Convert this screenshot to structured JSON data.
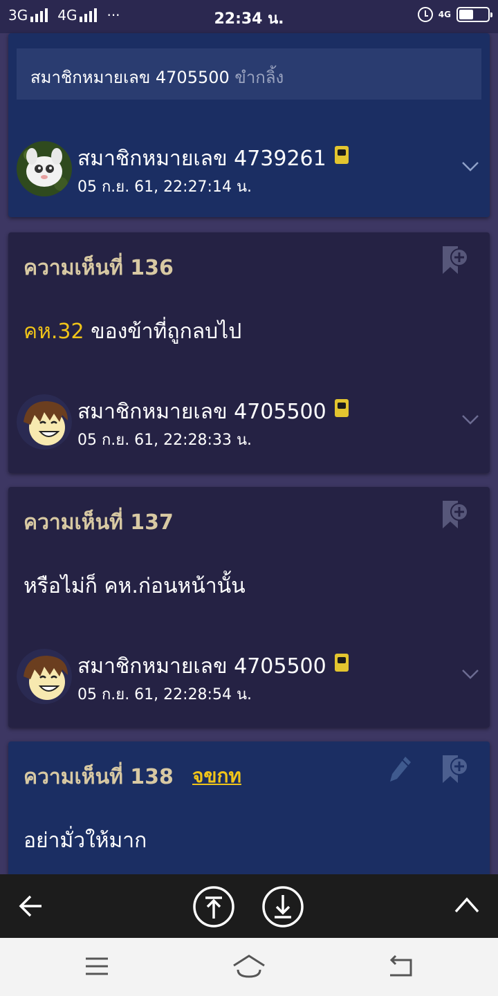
{
  "status_bar": {
    "left": [
      "3G",
      "4G",
      "···"
    ],
    "time": "22:34 น.",
    "network_right": "4G"
  },
  "top_card": {
    "quote": {
      "name": "สมาชิกหมายเลข 4705500",
      "note": "ขำกลิ้ง"
    },
    "user": {
      "name": "สมาชิกหมายเลข 4739261",
      "date": "05 ก.ย. 61, 22:27:14 น."
    }
  },
  "comments": [
    {
      "title": "ความเห็นที่ 136",
      "body_ref": "คห.32",
      "body_text": " ของข้าที่ถูกลบไป",
      "user": {
        "name": "สมาชิกหมายเลข 4705500",
        "date": "05 ก.ย. 61, 22:28:33 น."
      }
    },
    {
      "title": "ความเห็นที่ 137",
      "body_ref": "",
      "body_text": "หรือไม่ก็ คห.ก่อนหน้านั้น",
      "user": {
        "name": "สมาชิกหมายเลข 4705500",
        "date": "05 ก.ย. 61, 22:28:54 น."
      }
    },
    {
      "title": "ความเห็นที่ 138",
      "mod_tag": "จขกท",
      "body_ref": "",
      "body_text": "อย่ามั่วให้มาก"
    }
  ],
  "icons": {
    "bookmark": "bookmark-add-icon",
    "pencil": "edit-pencil-icon",
    "chevron": "chevron-down-icon",
    "back": "arrow-left-icon",
    "scroll_top": "scroll-to-top-icon",
    "scroll_bottom": "scroll-to-bottom-icon",
    "collapse": "chevron-up-icon"
  },
  "colors": {
    "page_bg": "#3d3763",
    "card_blue": "#1b2e63",
    "card_navy": "#252244",
    "title_tan": "#d8c9a3",
    "accent_yellow": "#f0c419"
  }
}
